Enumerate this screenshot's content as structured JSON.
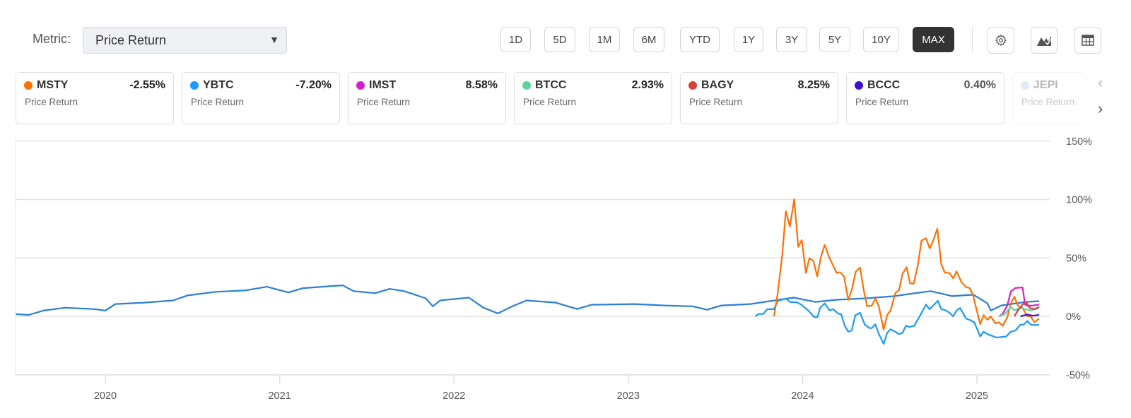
{
  "metric": {
    "label": "Metric:",
    "selected": "Price Return"
  },
  "ranges": [
    {
      "label": "1D",
      "active": false
    },
    {
      "label": "5D",
      "active": false
    },
    {
      "label": "1M",
      "active": false
    },
    {
      "label": "6M",
      "active": false
    },
    {
      "label": "YTD",
      "active": false
    },
    {
      "label": "1Y",
      "active": false
    },
    {
      "label": "3Y",
      "active": false
    },
    {
      "label": "5Y",
      "active": false
    },
    {
      "label": "10Y",
      "active": false
    },
    {
      "label": "MAX",
      "active": true
    }
  ],
  "tools": [
    "gear-icon",
    "chart-type-icon",
    "table-icon"
  ],
  "legend": [
    {
      "symbol": "MSTY",
      "value": "-2.55%",
      "metric": "Price Return",
      "color": "#ff7000"
    },
    {
      "symbol": "YBTC",
      "value": "-7.20%",
      "metric": "Price Return",
      "color": "#1a9bf7"
    },
    {
      "symbol": "IMST",
      "value": "8.58%",
      "metric": "Price Return",
      "color": "#d41fc8"
    },
    {
      "symbol": "BTCC",
      "value": "2.93%",
      "metric": "Price Return",
      "color": "#5fd19a"
    },
    {
      "symbol": "BAGY",
      "value": "8.25%",
      "metric": "Price Return",
      "color": "#d8413a"
    },
    {
      "symbol": "BCCC",
      "value": "0.40%",
      "metric": "Price Return",
      "color": "#3f0fd6"
    },
    {
      "symbol": "JEPI",
      "value": "",
      "metric": "Price Return",
      "color": "#a9c7f3"
    }
  ],
  "chart_data": {
    "type": "line",
    "title": "",
    "xlabel": "",
    "ylabel": "",
    "xlim": [
      2019.485,
      2025.418
    ],
    "ylim": [
      -50,
      150
    ],
    "x_ticks": [
      "2020",
      "2021",
      "2022",
      "2023",
      "2024",
      "2025"
    ],
    "y_ticks": [
      "150%",
      "100%",
      "50%",
      "0%",
      "-50%"
    ],
    "y_tick_values": [
      150,
      100,
      50,
      0,
      -50
    ],
    "grid": true,
    "series": [
      {
        "name": "JEPI",
        "color": "#2a7fd9",
        "points": [
          [
            2019.487,
            1.9
          ],
          [
            2019.561,
            1.2
          ],
          [
            2019.644,
            4.9
          ],
          [
            2019.768,
            7.4
          ],
          [
            2019.934,
            6.2
          ],
          [
            2020.0,
            4.9
          ],
          [
            2020.058,
            10.5
          ],
          [
            2020.224,
            11.7
          ],
          [
            2020.389,
            13.6
          ],
          [
            2020.472,
            17.9
          ],
          [
            2020.637,
            21.0
          ],
          [
            2020.803,
            22.2
          ],
          [
            2020.927,
            25.3
          ],
          [
            2021.051,
            20.4
          ],
          [
            2021.134,
            24.1
          ],
          [
            2021.3,
            25.9
          ],
          [
            2021.362,
            26.5
          ],
          [
            2021.424,
            21.6
          ],
          [
            2021.548,
            19.8
          ],
          [
            2021.631,
            23.5
          ],
          [
            2021.714,
            21.6
          ],
          [
            2021.838,
            15.4
          ],
          [
            2021.879,
            8.6
          ],
          [
            2021.921,
            13.6
          ],
          [
            2022.086,
            16.0
          ],
          [
            2022.169,
            7.4
          ],
          [
            2022.252,
            2.5
          ],
          [
            2022.334,
            8.6
          ],
          [
            2022.417,
            13.6
          ],
          [
            2022.583,
            11.7
          ],
          [
            2022.707,
            6.2
          ],
          [
            2022.79,
            9.9
          ],
          [
            2023.038,
            10.5
          ],
          [
            2023.204,
            9.3
          ],
          [
            2023.369,
            8.6
          ],
          [
            2023.452,
            5.6
          ],
          [
            2023.535,
            9.3
          ],
          [
            2023.7,
            10.5
          ],
          [
            2023.866,
            14.2
          ],
          [
            2023.949,
            16.0
          ],
          [
            2024.073,
            12.3
          ],
          [
            2024.197,
            14.2
          ],
          [
            2024.363,
            15.4
          ],
          [
            2024.528,
            17.3
          ],
          [
            2024.611,
            19.1
          ],
          [
            2024.735,
            21.6
          ],
          [
            2024.859,
            17.3
          ],
          [
            2024.98,
            18.5
          ],
          [
            2025.06,
            11.1
          ],
          [
            2025.08,
            4.9
          ],
          [
            2025.14,
            9.3
          ],
          [
            2025.28,
            12.3
          ],
          [
            2025.357,
            13.0
          ]
        ]
      },
      {
        "name": "YBTC",
        "color": "#1a9bf7",
        "points": [
          [
            2023.728,
            0
          ],
          [
            2023.748,
            2.0
          ],
          [
            2023.775,
            2.0
          ],
          [
            2023.796,
            6.1
          ],
          [
            2023.836,
            6.1
          ],
          [
            2023.857,
            13.2
          ],
          [
            2023.904,
            15.2
          ],
          [
            2023.931,
            12.1
          ],
          [
            2023.965,
            12.1
          ],
          [
            2023.992,
            10.1
          ],
          [
            2024.032,
            5.1
          ],
          [
            2024.066,
            -0.6
          ],
          [
            2024.086,
            -0.6
          ],
          [
            2024.1,
            7.1
          ],
          [
            2024.127,
            11.1
          ],
          [
            2024.154,
            5.1
          ],
          [
            2024.174,
            6.1
          ],
          [
            2024.208,
            2.0
          ],
          [
            2024.221,
            2.0
          ],
          [
            2024.242,
            -8.1
          ],
          [
            2024.262,
            -13.2
          ],
          [
            2024.282,
            -12.1
          ],
          [
            2024.303,
            1.0
          ],
          [
            2024.33,
            3.0
          ],
          [
            2024.357,
            -7.1
          ],
          [
            2024.384,
            -10.1
          ],
          [
            2024.397,
            -10.1
          ],
          [
            2024.417,
            -6.7
          ],
          [
            2024.438,
            -15.2
          ],
          [
            2024.465,
            -23.7
          ],
          [
            2024.485,
            -14.2
          ],
          [
            2024.505,
            -11.1
          ],
          [
            2024.532,
            -13.2
          ],
          [
            2024.553,
            -15.2
          ],
          [
            2024.573,
            -14.2
          ],
          [
            2024.593,
            -8.1
          ],
          [
            2024.613,
            -9.1
          ],
          [
            2024.64,
            -8.1
          ],
          [
            2024.668,
            -1.0
          ],
          [
            2024.708,
            10.1
          ],
          [
            2024.728,
            6.1
          ],
          [
            2024.762,
            11.1
          ],
          [
            2024.776,
            13.2
          ],
          [
            2024.796,
            6.1
          ],
          [
            2024.823,
            5.1
          ],
          [
            2024.843,
            3.0
          ],
          [
            2024.864,
            0
          ],
          [
            2024.884,
            5.1
          ],
          [
            2024.904,
            7.1
          ],
          [
            2024.938,
            -2.0
          ],
          [
            2024.958,
            -3.0
          ],
          [
            2024.985,
            -5.1
          ],
          [
            2025.019,
            -17.2
          ],
          [
            2025.039,
            -13.2
          ],
          [
            2025.06,
            -15.2
          ],
          [
            2025.114,
            -18.2
          ],
          [
            2025.168,
            -17.2
          ],
          [
            2025.195,
            -13.2
          ],
          [
            2025.222,
            -12.1
          ],
          [
            2025.249,
            -7.1
          ],
          [
            2025.269,
            -7.1
          ],
          [
            2025.289,
            -4.0
          ],
          [
            2025.31,
            -7.1
          ],
          [
            2025.337,
            -7.5
          ],
          [
            2025.357,
            -7.1
          ]
        ]
      },
      {
        "name": "MSTY",
        "color": "#ff7000",
        "points": [
          [
            2023.836,
            0
          ],
          [
            2023.857,
            19.2
          ],
          [
            2023.884,
            53.6
          ],
          [
            2023.904,
            90.1
          ],
          [
            2023.927,
            76.9
          ],
          [
            2023.952,
            100.2
          ],
          [
            2023.975,
            59.5
          ],
          [
            2023.995,
            65.2
          ],
          [
            2024.019,
            37.2
          ],
          [
            2024.039,
            49.8
          ],
          [
            2024.062,
            47.4
          ],
          [
            2024.084,
            34.2
          ],
          [
            2024.106,
            51.4
          ],
          [
            2024.127,
            61.1
          ],
          [
            2024.153,
            50.4
          ],
          [
            2024.195,
            37.2
          ],
          [
            2024.215,
            37.7
          ],
          [
            2024.238,
            34.2
          ],
          [
            2024.262,
            14.0
          ],
          [
            2024.283,
            23.1
          ],
          [
            2024.305,
            38.3
          ],
          [
            2024.33,
            41.7
          ],
          [
            2024.35,
            23.1
          ],
          [
            2024.37,
            8.7
          ],
          [
            2024.397,
            9.1
          ],
          [
            2024.418,
            15.2
          ],
          [
            2024.438,
            8.1
          ],
          [
            2024.465,
            -11.5
          ],
          [
            2024.485,
            1.0
          ],
          [
            2024.505,
            5.1
          ],
          [
            2024.533,
            20.2
          ],
          [
            2024.553,
            22.3
          ],
          [
            2024.573,
            36.4
          ],
          [
            2024.597,
            42.0
          ],
          [
            2024.616,
            28.3
          ],
          [
            2024.637,
            27.9
          ],
          [
            2024.661,
            43.5
          ],
          [
            2024.682,
            64.8
          ],
          [
            2024.708,
            66.8
          ],
          [
            2024.729,
            58.1
          ],
          [
            2024.749,
            64.8
          ],
          [
            2024.773,
            74.9
          ],
          [
            2024.796,
            44.5
          ],
          [
            2024.816,
            37.4
          ],
          [
            2024.843,
            37.0
          ],
          [
            2024.864,
            32.4
          ],
          [
            2024.883,
            38.5
          ],
          [
            2024.911,
            29.4
          ],
          [
            2024.938,
            24.9
          ],
          [
            2024.958,
            24.3
          ],
          [
            2024.978,
            18.2
          ],
          [
            2024.999,
            5.1
          ],
          [
            2025.019,
            -6.7
          ],
          [
            2025.039,
            1.0
          ],
          [
            2025.06,
            -3.0
          ],
          [
            2025.079,
            0
          ],
          [
            2025.107,
            -6.1
          ],
          [
            2025.127,
            -5.1
          ],
          [
            2025.148,
            -8.1
          ],
          [
            2025.174,
            -1.0
          ],
          [
            2025.195,
            11.1
          ],
          [
            2025.215,
            16.8
          ],
          [
            2025.235,
            9.1
          ],
          [
            2025.262,
            7.1
          ],
          [
            2025.289,
            0
          ],
          [
            2025.309,
            0
          ],
          [
            2025.33,
            -5.1
          ],
          [
            2025.357,
            -2.0
          ]
        ]
      },
      {
        "name": "IMST",
        "color": "#d41fc8",
        "points": [
          [
            2025.127,
            0
          ],
          [
            2025.147,
            2.0
          ],
          [
            2025.174,
            9.1
          ],
          [
            2025.195,
            21.3
          ],
          [
            2025.222,
            24.3
          ],
          [
            2025.262,
            24.7
          ],
          [
            2025.276,
            10.1
          ],
          [
            2025.289,
            9.1
          ],
          [
            2025.316,
            9.1
          ],
          [
            2025.357,
            10.1
          ]
        ]
      },
      {
        "name": "BTCC",
        "color": "#5fd19a",
        "points": [
          [
            2025.127,
            0
          ],
          [
            2025.161,
            2.0
          ],
          [
            2025.195,
            8.1
          ],
          [
            2025.215,
            5.1
          ],
          [
            2025.249,
            7.1
          ],
          [
            2025.276,
            6.1
          ],
          [
            2025.31,
            5.1
          ],
          [
            2025.357,
            7.1
          ]
        ]
      },
      {
        "name": "BAGY",
        "color": "#d8413a",
        "points": [
          [
            2025.215,
            0
          ],
          [
            2025.235,
            5.1
          ],
          [
            2025.262,
            10.1
          ],
          [
            2025.283,
            12.1
          ],
          [
            2025.303,
            7.1
          ],
          [
            2025.33,
            6.1
          ],
          [
            2025.357,
            8.1
          ]
        ]
      },
      {
        "name": "BCCC",
        "color": "#3f0fd6",
        "points": [
          [
            2025.25,
            0
          ],
          [
            2025.29,
            1.5
          ],
          [
            2025.32,
            0.5
          ],
          [
            2025.357,
            1.2
          ]
        ]
      }
    ]
  }
}
